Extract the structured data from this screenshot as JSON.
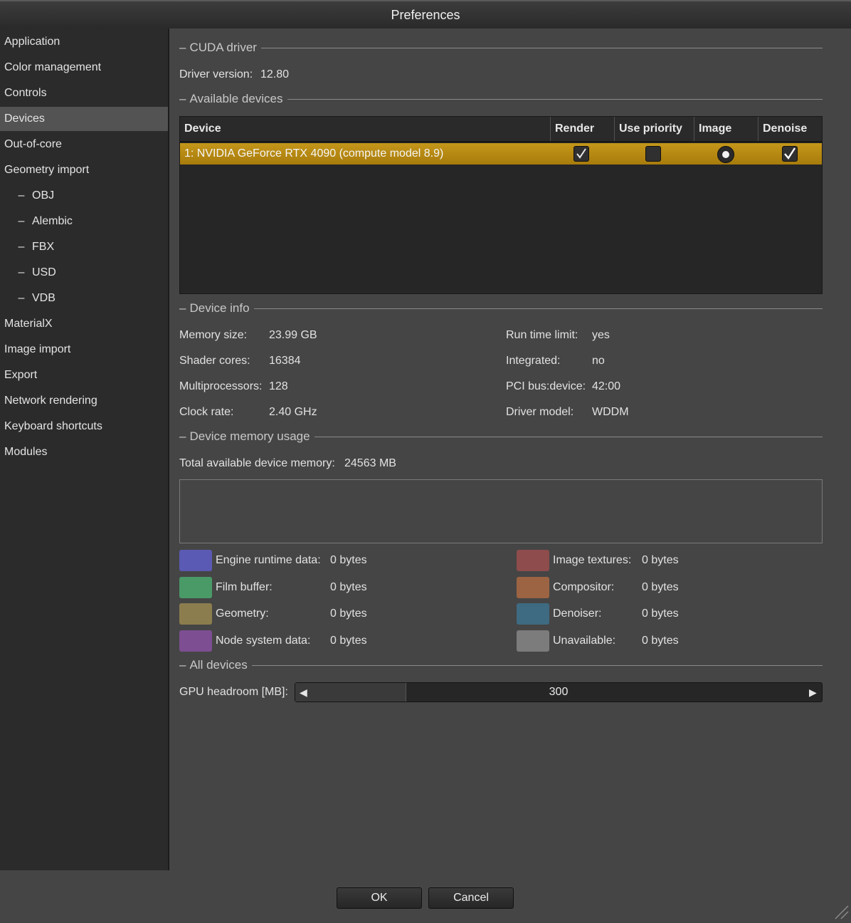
{
  "window": {
    "title": "Preferences"
  },
  "sidebar": {
    "items": [
      {
        "label": "Application"
      },
      {
        "label": "Color management"
      },
      {
        "label": "Controls"
      },
      {
        "label": "Devices",
        "selected": true
      },
      {
        "label": "Out-of-core"
      },
      {
        "label": "Geometry import"
      },
      {
        "label": "OBJ",
        "sub": true
      },
      {
        "label": "Alembic",
        "sub": true
      },
      {
        "label": "FBX",
        "sub": true
      },
      {
        "label": "USD",
        "sub": true
      },
      {
        "label": "VDB",
        "sub": true
      },
      {
        "label": "MaterialX"
      },
      {
        "label": "Image import"
      },
      {
        "label": "Export"
      },
      {
        "label": "Network rendering"
      },
      {
        "label": "Keyboard shortcuts"
      },
      {
        "label": "Modules"
      }
    ],
    "sub_prefix": "–"
  },
  "cuda": {
    "header": "CUDA driver",
    "driver_label": "Driver version:",
    "driver_value": "12.80"
  },
  "available": {
    "header": "Available devices",
    "columns": [
      "Device",
      "Render",
      "Use priority",
      "Image",
      "Denoise"
    ],
    "rows": [
      {
        "device": "1: NVIDIA GeForce RTX 4090 (compute model 8.9)",
        "render": true,
        "use_priority": false,
        "image": true,
        "denoise": true
      }
    ]
  },
  "device_info": {
    "header": "Device info",
    "left": [
      {
        "label": "Memory size:",
        "value": "23.99 GB"
      },
      {
        "label": "Shader cores:",
        "value": "16384"
      },
      {
        "label": "Multiprocessors:",
        "value": "128"
      },
      {
        "label": "Clock rate:",
        "value": "2.40 GHz"
      }
    ],
    "right": [
      {
        "label": "Run time limit:",
        "value": "yes"
      },
      {
        "label": "Integrated:",
        "value": "no"
      },
      {
        "label": "PCI bus:device:",
        "value": "42:00"
      },
      {
        "label": "Driver model:",
        "value": "WDDM"
      }
    ]
  },
  "memory": {
    "header": "Device memory usage",
    "total_label": "Total available device memory:",
    "total_value": "24563 MB",
    "legend_left": [
      {
        "label": "Engine runtime data:",
        "value": "0 bytes",
        "color": "#5a5ab4"
      },
      {
        "label": "Film buffer:",
        "value": "0 bytes",
        "color": "#4a9a68"
      },
      {
        "label": "Geometry:",
        "value": "0 bytes",
        "color": "#8c7d4e"
      },
      {
        "label": "Node system data:",
        "value": "0 bytes",
        "color": "#7d4e92"
      }
    ],
    "legend_right": [
      {
        "label": "Image textures:",
        "value": "0 bytes",
        "color": "#8e4c4c"
      },
      {
        "label": "Compositor:",
        "value": "0 bytes",
        "color": "#9c6442"
      },
      {
        "label": "Denoiser:",
        "value": "0 bytes",
        "color": "#3e6a82"
      },
      {
        "label": "Unavailable:",
        "value": "0 bytes",
        "color": "#7c7c7c"
      }
    ]
  },
  "all_devices": {
    "header": "All devices",
    "headroom_label": "GPU headroom [MB]:",
    "headroom_value": "300",
    "headroom_fill_fraction": 0.21
  },
  "buttons": {
    "ok": "OK",
    "cancel": "Cancel"
  }
}
